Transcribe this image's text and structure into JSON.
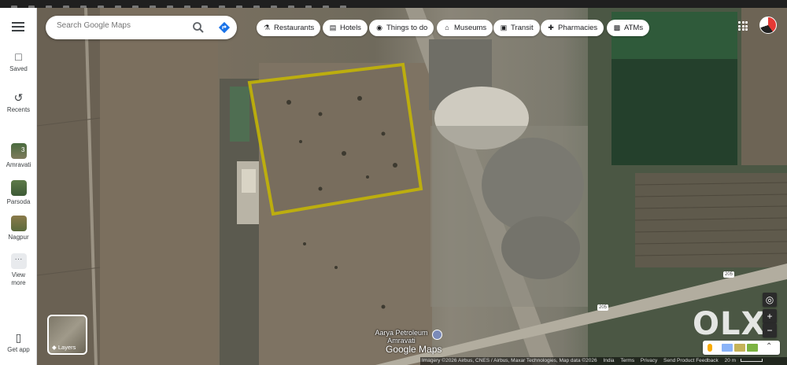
{
  "search": {
    "placeholder": "Search Google Maps"
  },
  "chips": [
    {
      "label": "Restaurants",
      "icon": "fork-knife-icon"
    },
    {
      "label": "Hotels",
      "icon": "bed-icon"
    },
    {
      "label": "Things to do",
      "icon": "camera-icon"
    },
    {
      "label": "Museums",
      "icon": "museum-icon"
    },
    {
      "label": "Transit",
      "icon": "train-icon"
    },
    {
      "label": "Pharmacies",
      "icon": "pharmacy-icon"
    },
    {
      "label": "ATMs",
      "icon": "atm-icon"
    }
  ],
  "sidebar": {
    "saved": "Saved",
    "recents": "Recents",
    "places": [
      {
        "label": "Amravati",
        "badge": "3"
      },
      {
        "label": "Parsoda"
      },
      {
        "label": "Nagpur"
      }
    ],
    "view_more": "View\nmore",
    "get_app": "Get app"
  },
  "map": {
    "layers_label": "Layers",
    "poi_label": "Aarya Petroleum\nAmravati",
    "logo_text": "Google Maps",
    "road_badges": [
      "205",
      "205"
    ],
    "watermark": "OLX",
    "highlight_color": "#c8b900"
  },
  "attribution": {
    "imagery": "Imagery ©2026 Airbus, CNES / Airbus, Maxar Technologies, Map data ©2026",
    "country": "India",
    "terms": "Terms",
    "privacy": "Privacy",
    "feedback": "Send Product Feedback",
    "scale": "20 m"
  }
}
